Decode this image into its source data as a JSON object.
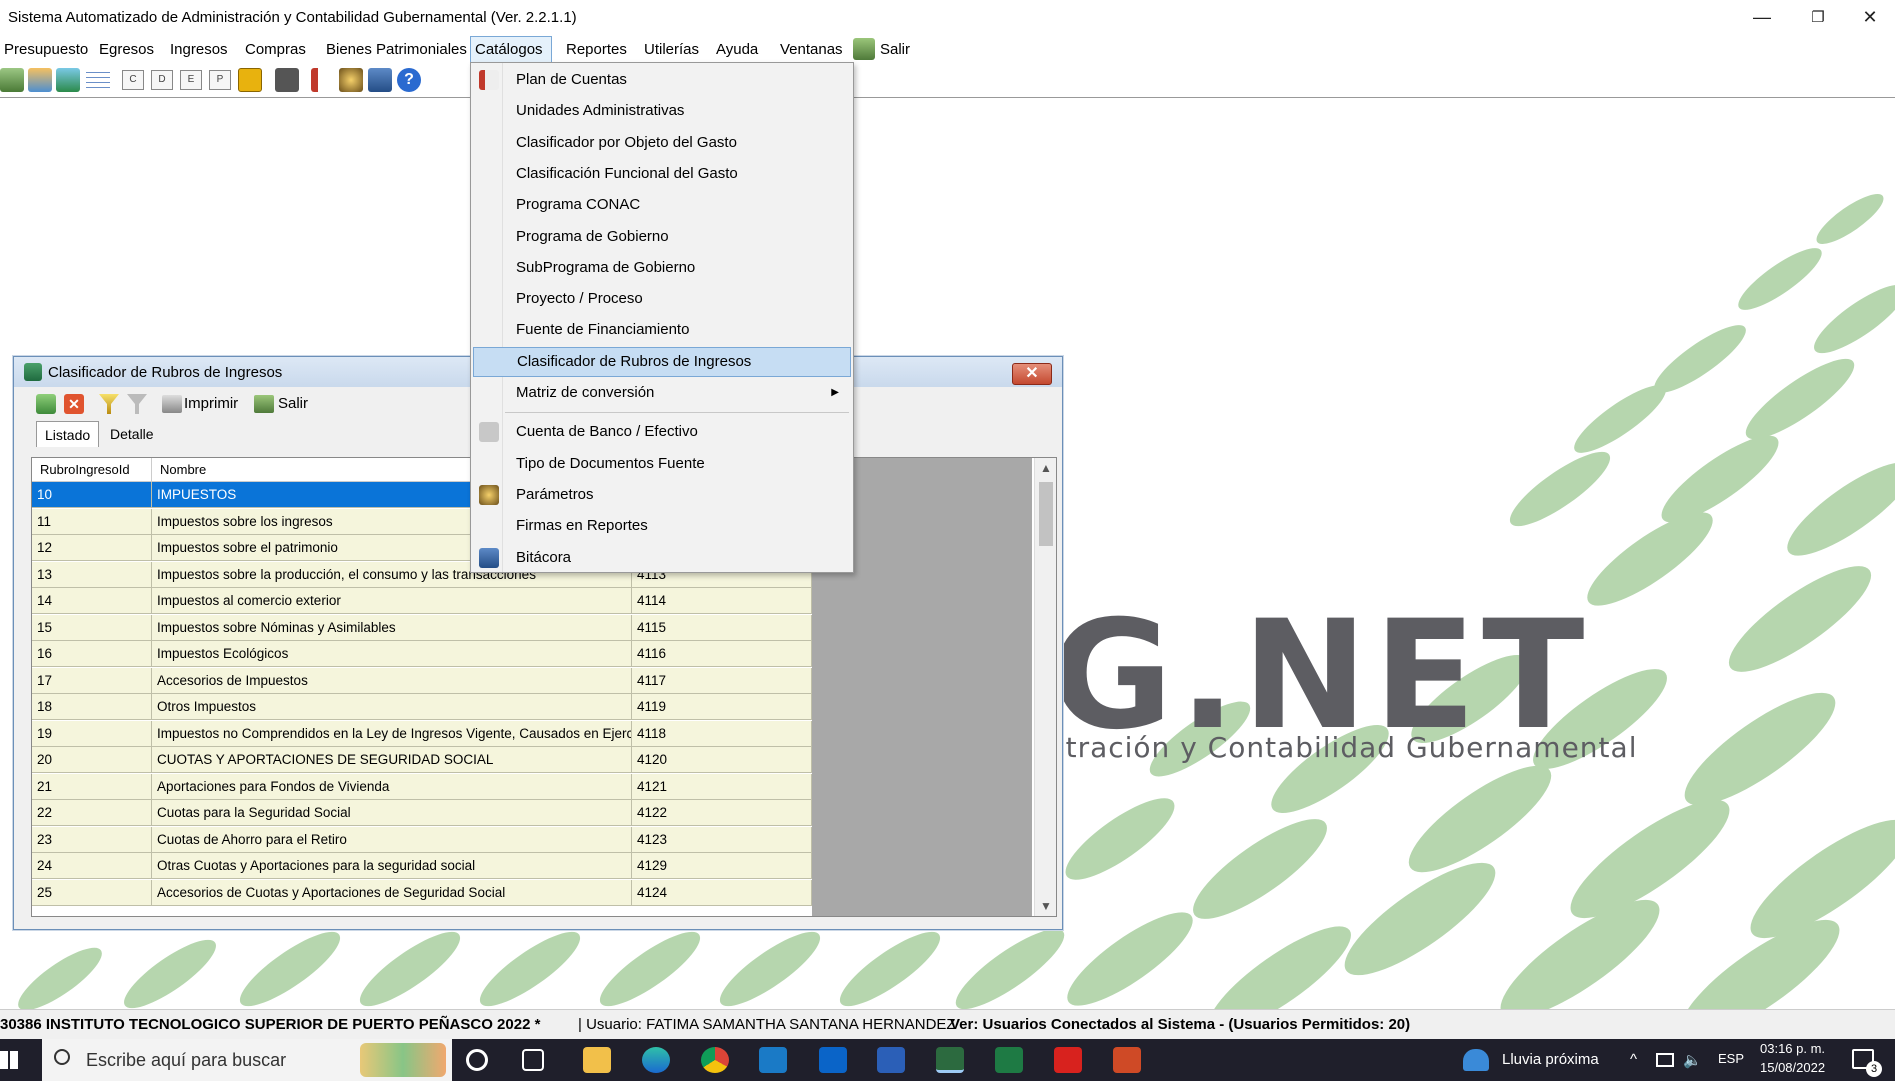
{
  "window": {
    "title": "Sistema Automatizado de Administración y Contabilidad Gubernamental  (Ver. 2.2.1.1)",
    "minimize": "—",
    "maximize": "❐",
    "close": "✕"
  },
  "menubar": {
    "items": [
      "Presupuesto",
      "Egresos",
      "Ingresos",
      "Compras",
      "Bienes Patrimoniales",
      "Catálogos",
      "Reportes",
      "Utilerías",
      "Ayuda",
      "Ventanas",
      "Salir"
    ]
  },
  "toolbar": {
    "letters": [
      "C",
      "D",
      "E",
      "P"
    ]
  },
  "logo": {
    "text": "G.NET",
    "subtitle": "stración y Contabilidad Gubernamental"
  },
  "child_window": {
    "title": "Clasificador de Rubros de Ingresos",
    "close": "✕",
    "print_label": "Imprimir",
    "exit_label": "Salir",
    "tabs": [
      "Listado",
      "Detalle"
    ],
    "columns": [
      "RubroIngresoId",
      "Nombre"
    ],
    "rows": [
      {
        "id": "10",
        "name": "IMPUESTOS",
        "code": ""
      },
      {
        "id": "11",
        "name": "Impuestos sobre los ingresos",
        "code": ""
      },
      {
        "id": "12",
        "name": "Impuestos sobre el patrimonio",
        "code": ""
      },
      {
        "id": "13",
        "name": "Impuestos sobre la producción, el consumo y las transacciones",
        "code": "4113"
      },
      {
        "id": "14",
        "name": "Impuestos al comercio exterior",
        "code": "4114"
      },
      {
        "id": "15",
        "name": "Impuestos sobre Nóminas y Asimilables",
        "code": "4115"
      },
      {
        "id": "16",
        "name": "Impuestos Ecológicos",
        "code": "4116"
      },
      {
        "id": "17",
        "name": "Accesorios de Impuestos",
        "code": "4117"
      },
      {
        "id": "18",
        "name": "Otros Impuestos",
        "code": "4119"
      },
      {
        "id": "19",
        "name": "Impuestos no Comprendidos en la Ley de Ingresos Vigente, Causados en Ejercici...",
        "code": "4118"
      },
      {
        "id": "20",
        "name": "CUOTAS Y APORTACIONES DE SEGURIDAD SOCIAL",
        "code": "4120"
      },
      {
        "id": "21",
        "name": "Aportaciones para Fondos de Vivienda",
        "code": "4121"
      },
      {
        "id": "22",
        "name": "Cuotas para la Seguridad Social",
        "code": "4122"
      },
      {
        "id": "23",
        "name": "Cuotas de Ahorro para el Retiro",
        "code": "4123"
      },
      {
        "id": "24",
        "name": "Otras Cuotas y Aportaciones para la seguridad social",
        "code": "4129"
      },
      {
        "id": "25",
        "name": "Accesorios de Cuotas y Aportaciones de Seguridad Social",
        "code": "4124"
      }
    ]
  },
  "dropdown": {
    "items": [
      "Plan de Cuentas",
      "Unidades Administrativas",
      "Clasificador por Objeto del Gasto",
      "Clasificación Funcional del Gasto",
      "Programa CONAC",
      "Programa de Gobierno",
      "SubPrograma de Gobierno",
      "Proyecto / Proceso",
      "Fuente de Financiamiento",
      "Clasificador de Rubros de Ingresos",
      "Matriz de conversión",
      "Cuenta de Banco / Efectivo",
      "Tipo de Documentos Fuente",
      "Parámetros",
      "Firmas en Reportes",
      "Bitácora"
    ]
  },
  "statusbar": {
    "entity": "30386 INSTITUTO TECNOLOGICO SUPERIOR DE PUERTO PEÑASCO  2022   *",
    "user": "| Usuario: FATIMA SAMANTHA SANTANA HERNANDEZ",
    "connected": "Ver: Usuarios Conectados al Sistema - (Usuarios Permitidos: 20)"
  },
  "taskbar": {
    "search_placeholder": "Escribe aquí para buscar",
    "weather": "Lluvia próxima",
    "lang": "ESP",
    "time": "03:16 p. m.",
    "date": "15/08/2022",
    "notif_count": "3"
  },
  "colors": {
    "accent_selected": "#0a74d8",
    "grid_row": "#f5f5dc",
    "menu_highlight": "#c6ddf3",
    "logo_gray": "#5d5d62",
    "pattern_green": "#a9cfa0"
  }
}
